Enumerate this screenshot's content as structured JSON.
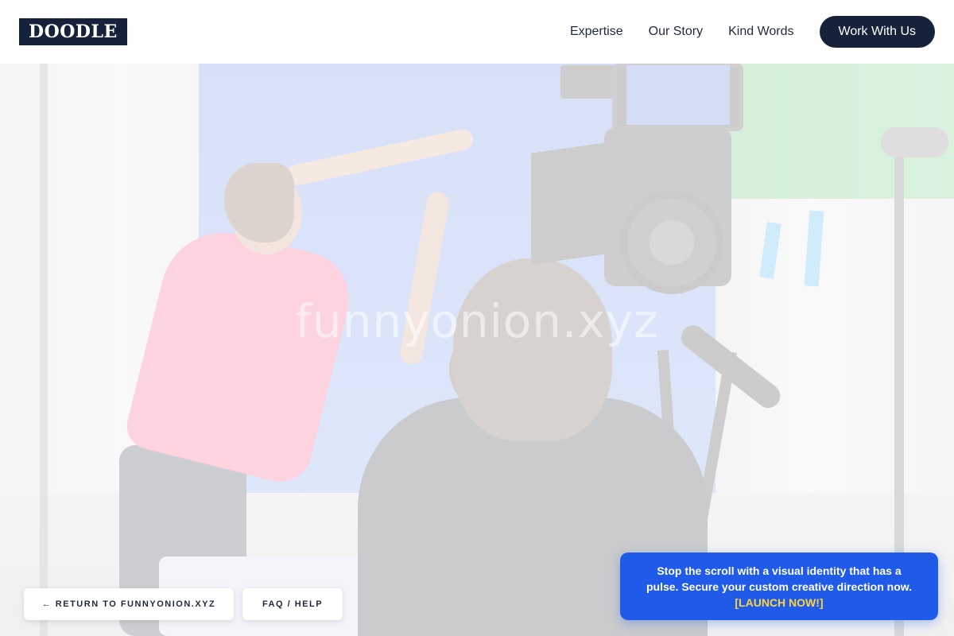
{
  "header": {
    "logo": "DOODLE",
    "nav": [
      {
        "label": "Expertise"
      },
      {
        "label": "Our Story"
      },
      {
        "label": "Kind Words"
      }
    ],
    "cta_label": "Work With Us"
  },
  "hero": {
    "watermark": "funnyonion.xyz",
    "image_description_icon": "film-studio-photo"
  },
  "footer_buttons": {
    "return_label": "← RETURN TO FUNNYONION.XYZ",
    "faq_label": "FAQ / HELP"
  },
  "promo": {
    "message": "Stop the scroll with a visual identity that has a pulse. Secure your custom creative direction now.",
    "link_label": "[LAUNCH NOW!]"
  },
  "colors": {
    "brand_dark": "#16213a",
    "promo_blue": "#1f5be8",
    "promo_link": "#ffd43b"
  }
}
